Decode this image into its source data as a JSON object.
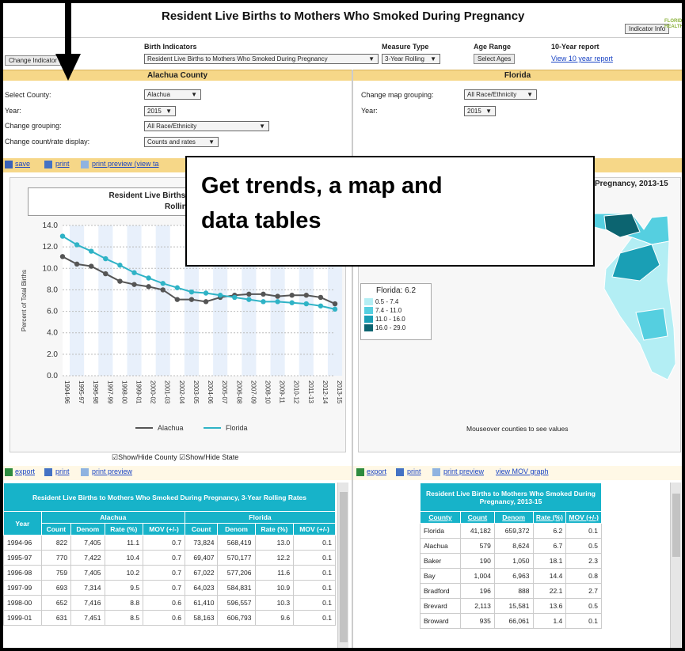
{
  "header": {
    "title": "Resident Live Births to Mothers Who Smoked During Pregnancy",
    "indicator_info": "Indicator Info",
    "logo_text": "FLORIDA HEALTH"
  },
  "controls": {
    "change_indicator": "Change Indicator",
    "birth_indicators_label": "Birth Indicators",
    "birth_indicator_value": "Resident Live Births to Mothers Who Smoked During Pregnancy",
    "measure_type_label": "Measure Type",
    "measure_type_value": "3-Year Rolling",
    "age_range_label": "Age Range",
    "select_ages": "Select Ages",
    "ten_year_label": "10-Year report",
    "view_10_year": "View 10 year report"
  },
  "county_panel": {
    "title": "Alachua County",
    "select_county_label": "Select County:",
    "select_county_value": "Alachua",
    "year_label": "Year:",
    "year_value": "2015",
    "grouping_label": "Change grouping:",
    "grouping_value": "All Race/Ethnicity",
    "display_label": "Change count/rate display:",
    "display_value": "Counts and rates"
  },
  "state_panel": {
    "title": "Florida",
    "map_grouping_label": "Change map grouping:",
    "map_grouping_value": "All Race/Ethnicity",
    "year_label": "Year:",
    "year_value": "2015"
  },
  "chart_toolbar": {
    "save": "save",
    "print": "print",
    "print_preview": "print preview (view ta"
  },
  "callout": {
    "line1": "Get trends, a map and",
    "line2": "data tables"
  },
  "chart_data": {
    "type": "line",
    "title_line1": "Resident Live Births to Mothers Who",
    "title_line2": "Rolling",
    "ylabel": "Percent of Total Births",
    "ylim": [
      0,
      14
    ],
    "yticks": [
      "0.0",
      "2.0",
      "4.0",
      "6.0",
      "8.0",
      "10.0",
      "12.0",
      "14.0"
    ],
    "categories": [
      "1994-96",
      "1995-97",
      "1996-98",
      "1997-99",
      "1998-00",
      "1999-01",
      "2000-02",
      "2001-03",
      "2002-04",
      "2003-05",
      "2004-06",
      "2005-07",
      "2006-08",
      "2007-09",
      "2008-10",
      "2009-11",
      "2010-12",
      "2011-13",
      "2012-14",
      "2013-15"
    ],
    "series": [
      {
        "name": "Alachua",
        "color": "#555555",
        "values": [
          11.1,
          10.4,
          10.2,
          9.5,
          8.8,
          8.5,
          8.3,
          8.0,
          7.1,
          7.1,
          6.9,
          7.3,
          7.5,
          7.6,
          7.6,
          7.4,
          7.5,
          7.5,
          7.3,
          6.7
        ]
      },
      {
        "name": "Florida",
        "color": "#2fb3c6",
        "values": [
          13.0,
          12.2,
          11.6,
          10.9,
          10.3,
          9.6,
          9.1,
          8.6,
          8.2,
          7.8,
          7.7,
          7.5,
          7.3,
          7.1,
          6.9,
          6.9,
          6.8,
          6.7,
          6.5,
          6.2
        ]
      }
    ],
    "show_county": "Show/Hide County",
    "show_state": "Show/Hide State"
  },
  "map": {
    "title": "Pregnancy, 2013-15",
    "legend_title": "Florida: 6.2",
    "legend": [
      {
        "label": "0.5 - 7.4",
        "color": "#b3eef4"
      },
      {
        "label": "7.4 - 11.0",
        "color": "#55cfe0"
      },
      {
        "label": "11.0 - 16.0",
        "color": "#1a9fb5"
      },
      {
        "label": "16.0 - 29.0",
        "color": "#0c6470"
      }
    ],
    "hint": "Mouseover counties to see values"
  },
  "left_table_toolbar": {
    "export": "export",
    "print": "print",
    "print_preview": "print preview"
  },
  "right_table_toolbar": {
    "export": "export",
    "print": "print",
    "print_preview": "print preview",
    "mov_graph": "view MOV graph"
  },
  "left_table": {
    "title": "Resident Live Births to Mothers Who Smoked During Pregnancy, 3-Year Rolling Rates",
    "group1": "Alachua",
    "group2": "Florida",
    "columns": [
      "Year",
      "Count",
      "Denom",
      "Rate (%)",
      "MOV (+/-)",
      "Count",
      "Denom",
      "Rate (%)",
      "MOV (+/-)"
    ],
    "rows": [
      [
        "1994-96",
        "822",
        "7,405",
        "11.1",
        "0.7",
        "73,824",
        "568,419",
        "13.0",
        "0.1"
      ],
      [
        "1995-97",
        "770",
        "7,422",
        "10.4",
        "0.7",
        "69,407",
        "570,177",
        "12.2",
        "0.1"
      ],
      [
        "1996-98",
        "759",
        "7,405",
        "10.2",
        "0.7",
        "67,022",
        "577,206",
        "11.6",
        "0.1"
      ],
      [
        "1997-99",
        "693",
        "7,314",
        "9.5",
        "0.7",
        "64,023",
        "584,831",
        "10.9",
        "0.1"
      ],
      [
        "1998-00",
        "652",
        "7,416",
        "8.8",
        "0.6",
        "61,410",
        "596,557",
        "10.3",
        "0.1"
      ],
      [
        "1999-01",
        "631",
        "7,451",
        "8.5",
        "0.6",
        "58,163",
        "606,793",
        "9.6",
        "0.1"
      ]
    ]
  },
  "right_table": {
    "title": "Resident Live Births to Mothers Who Smoked During Pregnancy, 2013-15",
    "columns": [
      "County",
      "Count",
      "Denom",
      "Rate (%)",
      "MOV (+/-)"
    ],
    "rows": [
      [
        "Florida",
        "41,182",
        "659,372",
        "6.2",
        "0.1"
      ],
      [
        "Alachua",
        "579",
        "8,624",
        "6.7",
        "0.5"
      ],
      [
        "Baker",
        "190",
        "1,050",
        "18.1",
        "2.3"
      ],
      [
        "Bay",
        "1,004",
        "6,963",
        "14.4",
        "0.8"
      ],
      [
        "Bradford",
        "196",
        "888",
        "22.1",
        "2.7"
      ],
      [
        "Brevard",
        "2,113",
        "15,581",
        "13.6",
        "0.5"
      ],
      [
        "Broward",
        "935",
        "66,061",
        "1.4",
        "0.1"
      ]
    ]
  }
}
